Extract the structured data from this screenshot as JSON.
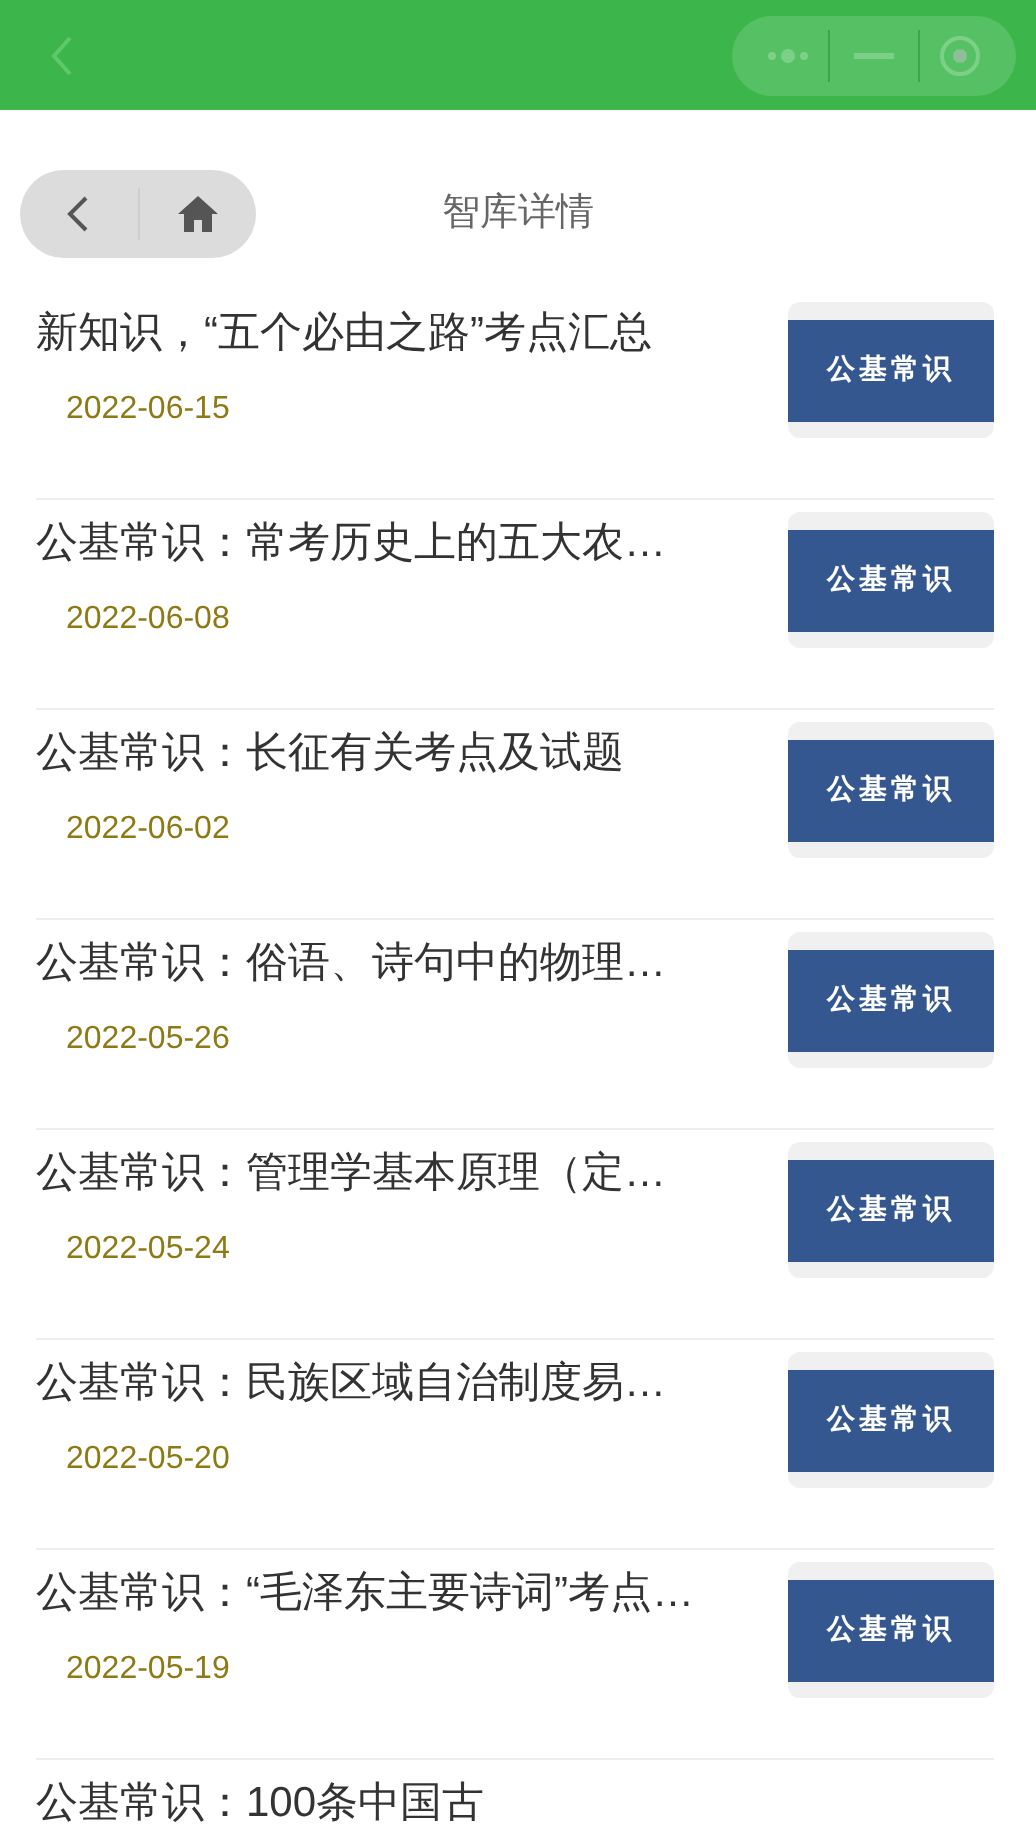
{
  "header": {
    "title": "智库详情"
  },
  "articles": [
    {
      "title": "新知识，“五个必由之路”考点汇总",
      "date": "2022-06-15",
      "thumb_label": "公基常识"
    },
    {
      "title": "公基常识：常考历史上的五大农…",
      "date": "2022-06-08",
      "thumb_label": "公基常识"
    },
    {
      "title": "公基常识：长征有关考点及试题",
      "date": "2022-06-02",
      "thumb_label": "公基常识"
    },
    {
      "title": "公基常识：俗语、诗句中的物理…",
      "date": "2022-05-26",
      "thumb_label": "公基常识"
    },
    {
      "title": "公基常识：管理学基本原理（定…",
      "date": "2022-05-24",
      "thumb_label": "公基常识"
    },
    {
      "title": "公基常识：民族区域自治制度易…",
      "date": "2022-05-20",
      "thumb_label": "公基常识"
    },
    {
      "title": "公基常识：“毛泽东主要诗词”考点…",
      "date": "2022-05-19",
      "thumb_label": "公基常识"
    },
    {
      "title": "公基常识：100条中国古"
    }
  ]
}
